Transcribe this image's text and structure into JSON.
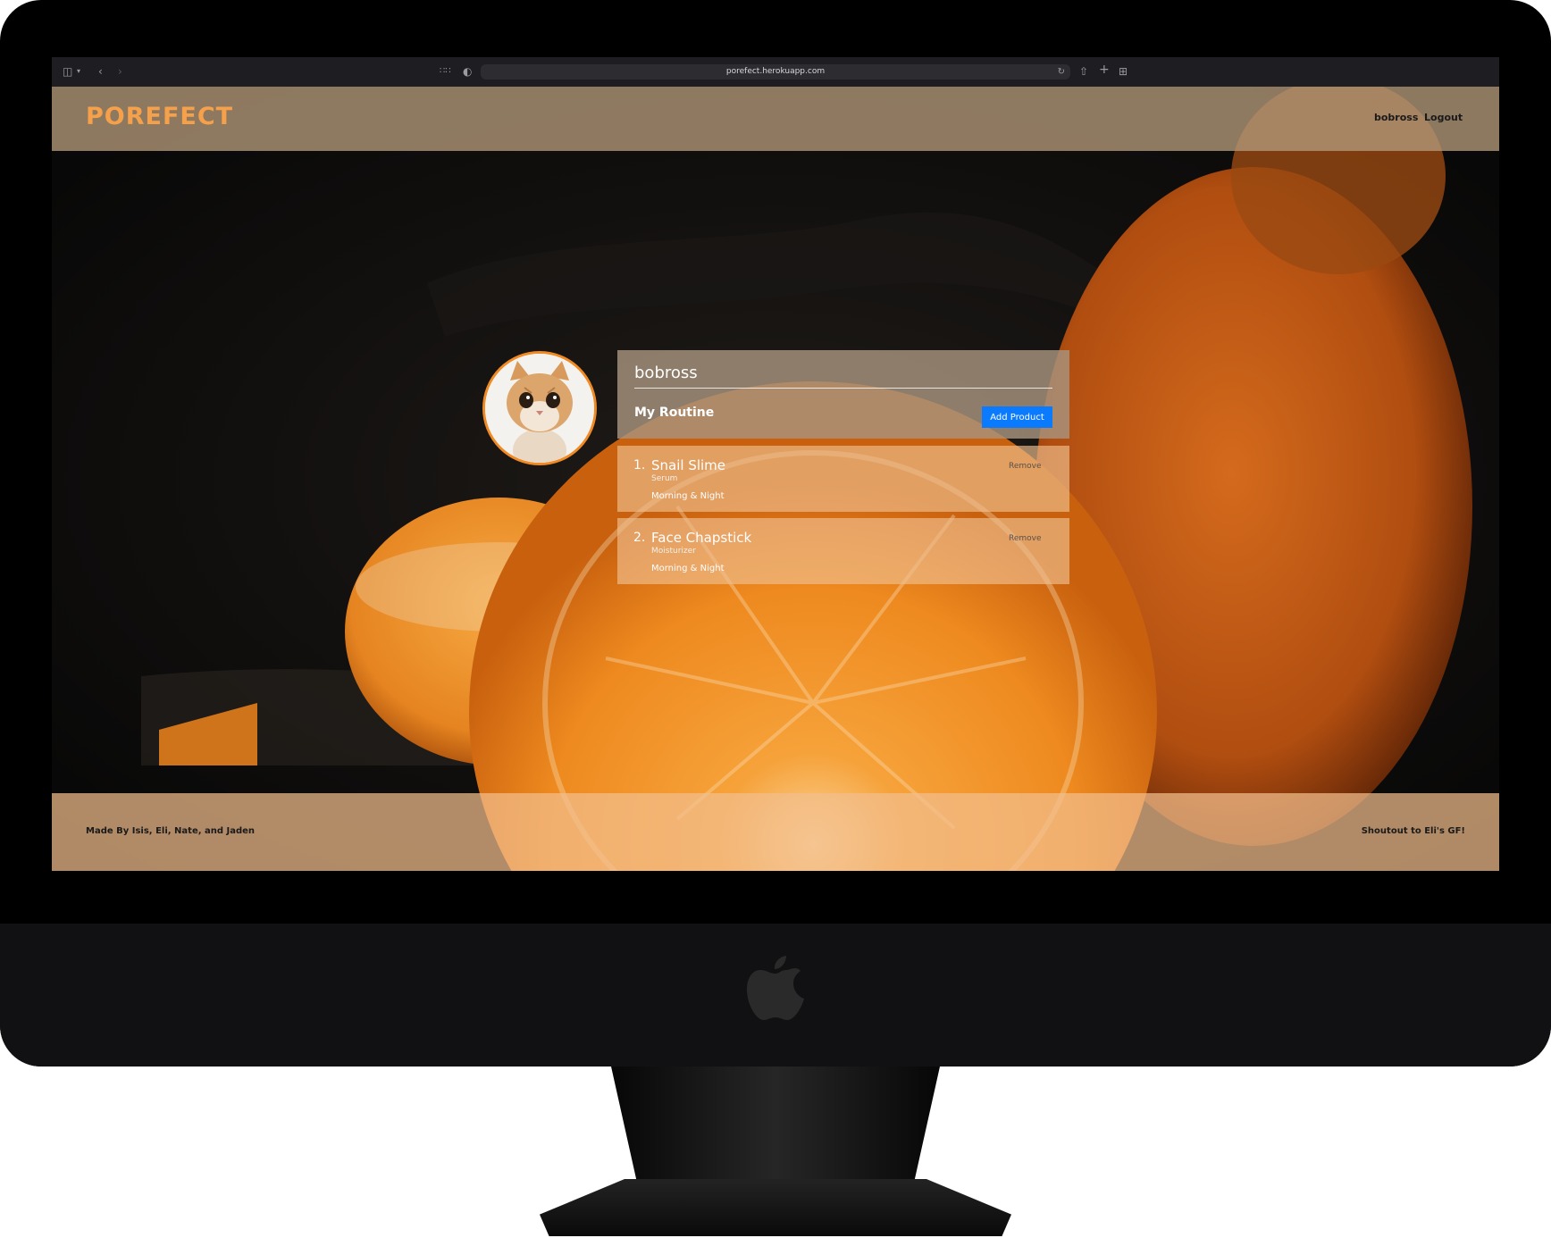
{
  "browser": {
    "url": "porefect.herokuapp.com"
  },
  "site": {
    "brand": "POREFECT",
    "nav": {
      "username": "bobross",
      "logout": "Logout"
    },
    "accent_color": "#f5a04a"
  },
  "profile": {
    "username": "bobross",
    "routine_title": "My Routine",
    "add_product_label": "Add Product"
  },
  "routine": [
    {
      "num": "1.",
      "name": "Snail Slime",
      "type": "Serum",
      "time": "Morning & Night",
      "remove_label": "Remove"
    },
    {
      "num": "2.",
      "name": "Face Chapstick",
      "type": "Moisturizer",
      "time": "Morning & Night",
      "remove_label": "Remove"
    }
  ],
  "footer": {
    "left": "Made By Isis, Eli, Nate, and Jaden",
    "right": "Shoutout to Eli's GF!"
  }
}
